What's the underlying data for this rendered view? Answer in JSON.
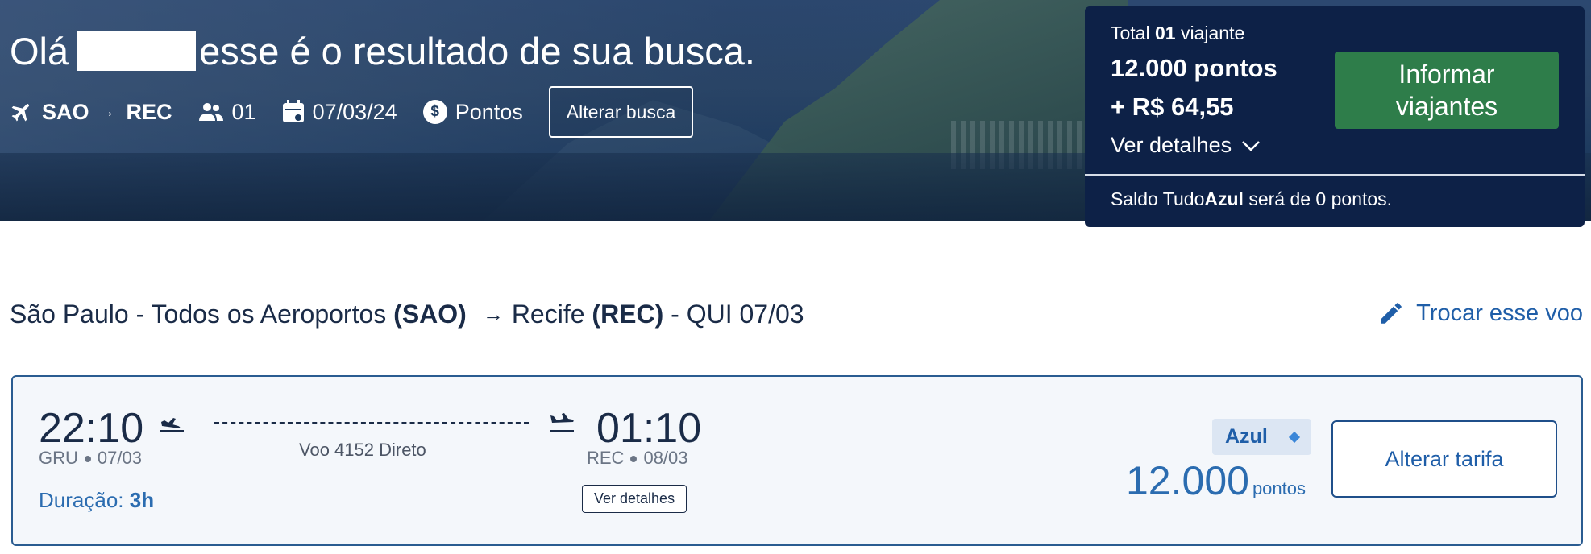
{
  "hero": {
    "greeting_prefix": "Olá",
    "greeting_suffix": "esse é o resultado de sua busca.",
    "search": {
      "origin": "SAO",
      "destination": "REC",
      "passengers": "01",
      "date": "07/03/24",
      "payment": "Pontos",
      "alter_label": "Alterar busca",
      "icons": [
        "airplane-icon",
        "people-icon",
        "calendar-icon",
        "dollar-coin-icon"
      ]
    }
  },
  "summary": {
    "total_prefix": "Total",
    "total_count": "01",
    "total_suffix": "viajante",
    "points": "12.000 pontos",
    "money": "+ R$ 64,55",
    "details_label": "Ver detalhes",
    "inform_line1": "Informar",
    "inform_line2": "viajantes",
    "saldo_prefix": "Saldo Tudo",
    "saldo_brand": "Azul",
    "saldo_suffix": "será de 0 pontos."
  },
  "route": {
    "origin_city": "São Paulo - Todos os Aeroportos",
    "origin_code": "(SAO)",
    "dest_city": "Recife",
    "dest_code": "(REC)",
    "date_label": "- QUI 07/03",
    "swap_label": "Trocar esse voo"
  },
  "flight": {
    "dep_time": "22:10",
    "dep_airport": "GRU",
    "dep_date": "07/03",
    "arr_time": "01:10",
    "arr_airport": "REC",
    "arr_date": "08/03",
    "flight_info": "Voo 4152 Direto",
    "duration_label": "Duração:",
    "duration_value": "3h",
    "details_label": "Ver detalhes",
    "fare_name": "Azul",
    "price_value": "12.000",
    "price_unit": "pontos",
    "change_fare_label": "Alterar tarifa"
  },
  "colors": {
    "hero_overlay": "#1d3a5e",
    "summary_bg": "#0d2147",
    "primary_green": "#2e7d4a",
    "link_blue": "#1f5ea8",
    "card_border": "#2a5c91"
  }
}
